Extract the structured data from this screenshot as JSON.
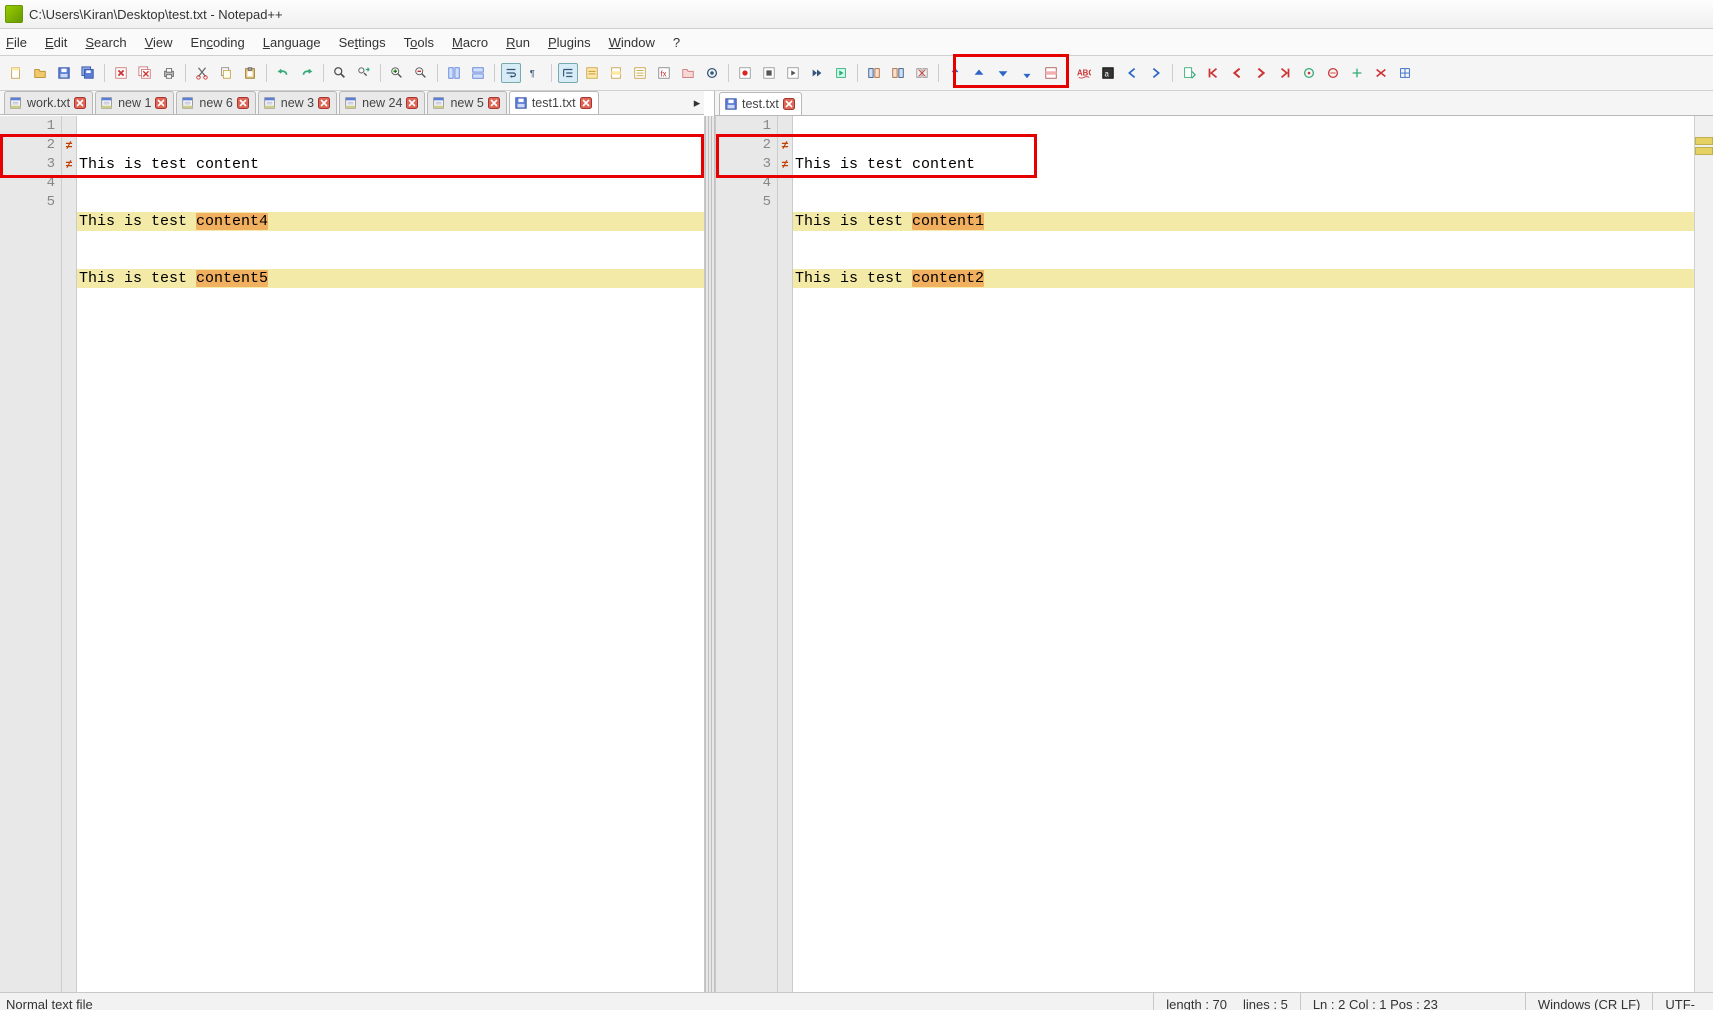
{
  "title": "C:\\Users\\Kiran\\Desktop\\test.txt - Notepad++",
  "menu": {
    "file": "File",
    "edit": "Edit",
    "search": "Search",
    "view": "View",
    "encoding": "Encoding",
    "language": "Language",
    "settings": "Settings",
    "tools": "Tools",
    "macro": "Macro",
    "run": "Run",
    "plugins": "Plugins",
    "window": "Window",
    "help": "?"
  },
  "left_tabs": [
    {
      "label": "work.txt",
      "active": false
    },
    {
      "label": "new 1",
      "active": false
    },
    {
      "label": "new 6",
      "active": false
    },
    {
      "label": "new 3",
      "active": false
    },
    {
      "label": "new 24",
      "active": false
    },
    {
      "label": "new 5",
      "active": false
    },
    {
      "label": "test1.txt",
      "active": true
    }
  ],
  "right_tabs": [
    {
      "label": "test.txt",
      "active": true
    }
  ],
  "left_lines": {
    "l1": "This is test content",
    "l2a": "This is test ",
    "l2b": "content4",
    "l3a": "This is test ",
    "l3b": "content5",
    "gn1": "1",
    "gn2": "2",
    "gn3": "3",
    "gn4": "4",
    "gn5": "5"
  },
  "right_lines": {
    "l1": "This is test content",
    "l2a": "This is test ",
    "l2b": "content1",
    "l3a": "This is test ",
    "l3b": "content2",
    "gn1": "1",
    "gn2": "2",
    "gn3": "3",
    "gn4": "4",
    "gn5": "5"
  },
  "marker": "≠",
  "status": {
    "filetype": "Normal text file",
    "length_label": "length : 70",
    "lines_label": "lines : 5",
    "pos_label": "Ln : 2    Col : 1    Pos : 23",
    "eol_label": "Windows (CR LF)",
    "enc_label": "UTF-"
  }
}
